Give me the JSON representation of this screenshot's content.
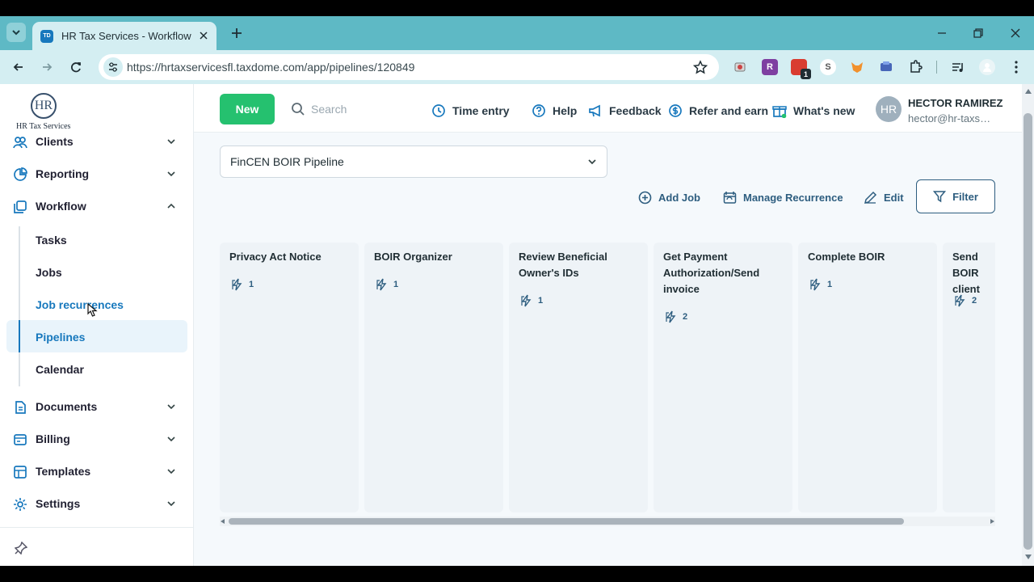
{
  "browser": {
    "tab_title": "HR Tax Services - Workflow",
    "favicon_text": "TD",
    "url": "https://hrtaxservicesfl.taxdome.com/app/pipelines/120849",
    "extensions": [
      {
        "name": "extension-generic-icon",
        "label": "",
        "color": "#d4eef2"
      },
      {
        "name": "extension-r-icon",
        "label": "R",
        "color": "#7e3fa1"
      },
      {
        "name": "extension-calendar-icon",
        "label": "1",
        "color": "#d93c30"
      },
      {
        "name": "extension-s-icon",
        "label": "S",
        "color": "#ffffff"
      },
      {
        "name": "extension-fox-icon",
        "label": "",
        "color": "#f1912d"
      },
      {
        "name": "extension-blue-icon",
        "label": "",
        "color": "#4766b8"
      }
    ]
  },
  "brand": {
    "logo_monogram": "HR",
    "logo_text": "HR Tax Services"
  },
  "sidebar": {
    "items": [
      {
        "label": "Clients",
        "icon": "clients-icon"
      },
      {
        "label": "Reporting",
        "icon": "reporting-icon"
      },
      {
        "label": "Workflow",
        "icon": "workflow-icon"
      },
      {
        "label": "Documents",
        "icon": "documents-icon"
      },
      {
        "label": "Billing",
        "icon": "billing-icon"
      },
      {
        "label": "Templates",
        "icon": "templates-icon"
      },
      {
        "label": "Settings",
        "icon": "settings-icon"
      }
    ],
    "workflow_subitems": [
      "Tasks",
      "Jobs",
      "Job recurrences",
      "Pipelines",
      "Calendar"
    ],
    "active_subitem": "Pipelines"
  },
  "header": {
    "new_label": "New",
    "search_placeholder": "Search",
    "links": [
      "Time entry",
      "Help",
      "Feedback",
      "Refer and earn",
      "What's new"
    ],
    "user_initials": "HR",
    "user_name": "HECTOR RAMIREZ",
    "user_email": "hector@hr-taxse..."
  },
  "pipeline": {
    "selected": "FinCEN BOIR Pipeline",
    "actions": [
      "Add Job",
      "Manage Recurrence",
      "Edit"
    ],
    "filter_label": "Filter",
    "stages": [
      {
        "title": "Privacy Act Notice",
        "count": "1"
      },
      {
        "title": "BOIR Organizer",
        "count": "1"
      },
      {
        "title": "Review Beneficial Owner's IDs",
        "count": "1"
      },
      {
        "title": "Get Payment Authorization/Send invoice",
        "count": "2"
      },
      {
        "title": "Complete BOIR",
        "count": "1"
      },
      {
        "title": "Send BOIR client",
        "count": "2"
      }
    ]
  },
  "colors": {
    "chrome": "#5eb9c5",
    "primary": "#1778bd",
    "new_button": "#25c16f",
    "active_nav": "#e9f4fb",
    "action_text": "#2d5d7f"
  }
}
